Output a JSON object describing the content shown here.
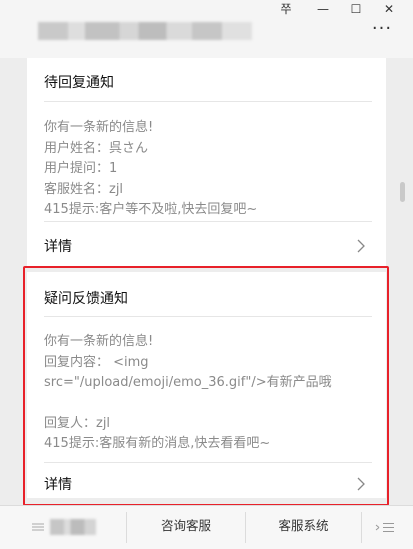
{
  "window": {
    "pin_label": "쭈",
    "minimize_label": "—",
    "maximize_label": "☐",
    "close_label": "✕",
    "more_label": "···"
  },
  "cards": [
    {
      "title": "待回复通知",
      "lines": [
        "你有一条新的信息!",
        "用户姓名：呉さん",
        "用户提问：1",
        "客服姓名：zjl",
        "415提示:客户等不及啦,快去回复吧~"
      ],
      "detail_label": "详情"
    },
    {
      "title": "疑问反馈通知",
      "lines": [
        "你有一条新的信息!",
        "回复内容：  <img",
        "src=\"/upload/emoji/emo_36.gif\"/>有新产品哦",
        "",
        "回复人：zjl",
        "415提示:客服有新的消息,快去看看吧~"
      ],
      "detail_label": "详情"
    }
  ],
  "bottom_menu": {
    "items": [
      "咨询客服",
      "客服系统"
    ]
  },
  "colors": {
    "highlight": "#e8212a",
    "background": "#ededed"
  }
}
